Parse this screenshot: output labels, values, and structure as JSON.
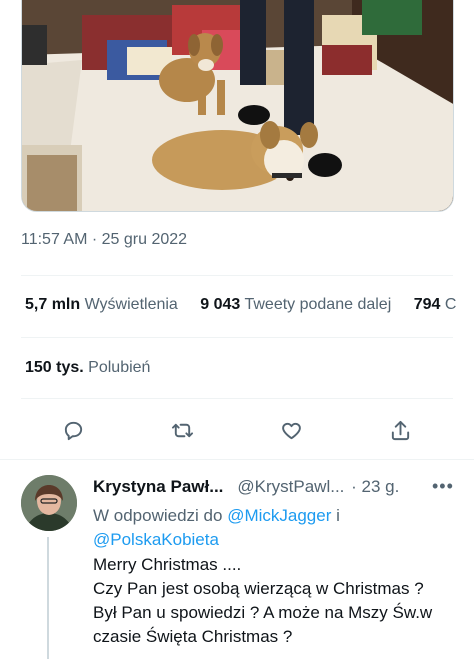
{
  "tweet": {
    "timestamp": "11:57 AM · 25 gru 2022",
    "stats": {
      "views_count": "5,7 mln",
      "views_label": "Wyświetlenia",
      "retweets_count": "9 043",
      "retweets_label": "Tweety podane dalej",
      "quotes_count": "794",
      "quotes_label": "C"
    },
    "likes": {
      "count": "150 tys.",
      "label": "Polubień"
    },
    "actions": [
      "reply-icon",
      "retweet-icon",
      "heart-icon",
      "share-icon"
    ]
  },
  "reply": {
    "name": "Krystyna Pawł...",
    "handle": "@KrystPawl...",
    "time": "· 23 g.",
    "more": "•••",
    "reply_prefix": "W odpowiedzi do",
    "mention_1": "@MickJagger",
    "conjunction": "i",
    "mention_2": "@PolskaKobieta",
    "lines": [
      "Merry Christmas ....",
      "Czy Pan jest osobą wierzącą w Christmas ?",
      "Był Pan u spowiedzi ? A może na Mszy Św.w",
      "czasie Święta Christmas ?"
    ]
  },
  "colors": {
    "text_primary": "#0f1419",
    "text_secondary": "#536471",
    "link": "#1d9bf0",
    "divider": "#eff3f4"
  }
}
